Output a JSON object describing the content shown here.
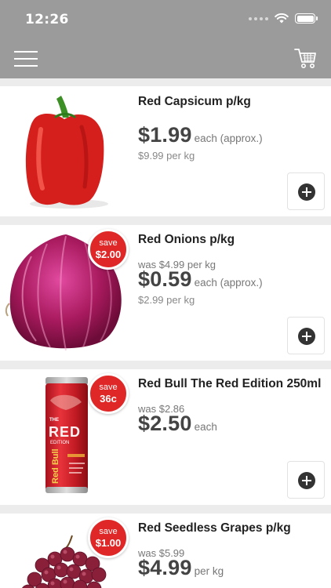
{
  "status_bar": {
    "time": "12:26",
    "icons": [
      "signal-dots-icon",
      "wifi-icon",
      "battery-icon"
    ]
  },
  "nav": {
    "menu_icon": "hamburger-menu-icon",
    "cart_icon": "cart-icon"
  },
  "products": [
    {
      "name": "Red Capsicum p/kg",
      "price": "$1.99",
      "unit": "each (approx.)",
      "per_kg": "$9.99 per kg",
      "image": "red-capsicum"
    },
    {
      "name": "Red Onions p/kg",
      "save_label": "save",
      "save_amount": "$2.00",
      "was": "was $4.99 per kg",
      "price": "$0.59",
      "unit": "each (approx.)",
      "per_kg": "$2.99 per kg",
      "image": "red-onion"
    },
    {
      "name": "Red Bull The Red Edition 250ml",
      "save_label": "save",
      "save_amount": "36c",
      "was": "was $2.86",
      "price": "$2.50",
      "unit": "each",
      "image": "red-bull-can",
      "can_text": {
        "the": "THE",
        "red": "RED",
        "edition": "EDITION",
        "brand": "Red Bull"
      }
    },
    {
      "name": "Red Seedless Grapes p/kg",
      "save_label": "save",
      "save_amount": "$1.00",
      "was": "was $5.99",
      "price": "$4.99",
      "unit": "per kg",
      "image": "red-grapes"
    }
  ],
  "colors": {
    "header": "#9b9b9b",
    "badge": "#e02727",
    "background": "#ececec"
  }
}
